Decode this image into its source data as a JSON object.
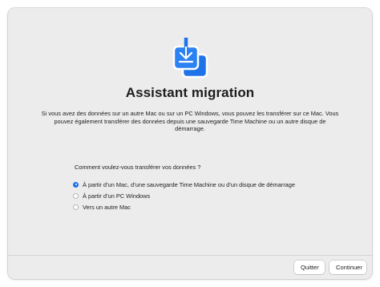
{
  "app": {
    "title": "Assistant migration",
    "icon": "migration-assistant-icon",
    "icon_color": "#1e73e8"
  },
  "description": "Si vous avez des données sur un autre Mac ou sur un PC Windows, vous pouvez les transférer sur ce Mac. Vous pouvez également transférer des données depuis une sauvegarde Time Machine ou un autre disque de démarrage.",
  "transfer": {
    "question": "Comment voulez-vous transférer vos données ?",
    "options": [
      {
        "label": "À partir d’un Mac, d’une sauvegarde Time Machine ou d’un disque de démarrage",
        "selected": true
      },
      {
        "label": "À partir d’un PC Windows",
        "selected": false
      },
      {
        "label": "Vers un autre Mac",
        "selected": false
      }
    ]
  },
  "footer": {
    "quit_label": "Quitter",
    "continue_label": "Continuer"
  },
  "colors": {
    "accent": "#1e6ee8",
    "window_bg": "#ececec"
  }
}
